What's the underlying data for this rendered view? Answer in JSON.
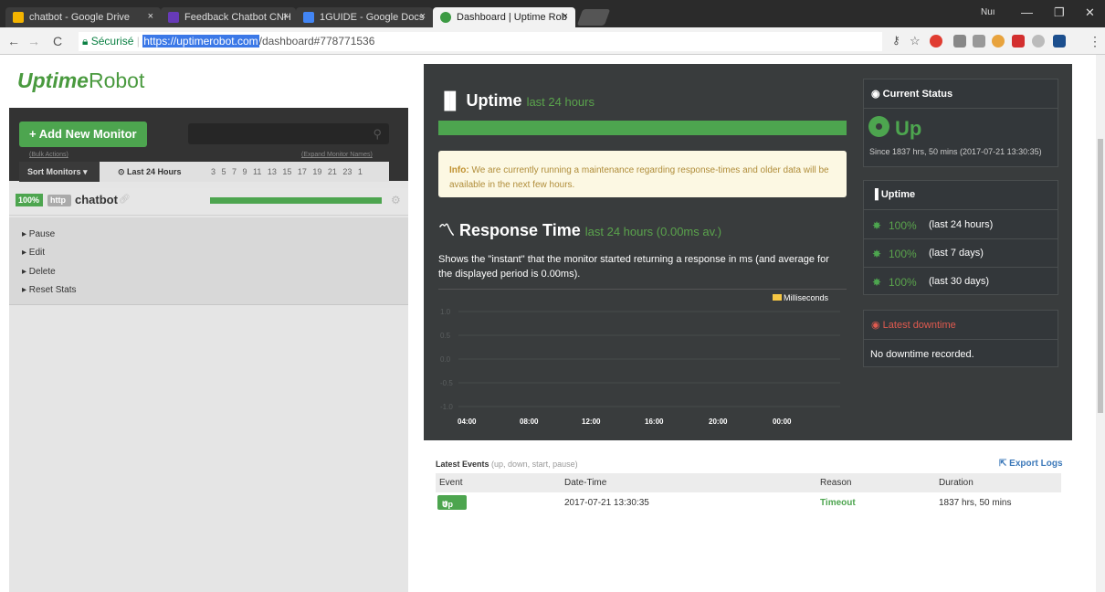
{
  "browser": {
    "tabs": [
      {
        "title": "chatbot - Google Drive",
        "close": "×",
        "icon_color": "#f4b400"
      },
      {
        "title": "Feedback Chatbot CNH",
        "close": "×",
        "icon_color": "#673ab7"
      },
      {
        "title": "1GUIDE - Google Docs",
        "close": "×",
        "icon_color": "#4285f4"
      },
      {
        "title": "Dashboard | Uptime Rob",
        "close": "×",
        "icon_color": "#3c9a43"
      }
    ],
    "user": "Nuı",
    "secure_label": "Sécurisé",
    "url_highlight": "https://uptimerobot.com",
    "url_rest": "/dashboard#778771536"
  },
  "sidebar": {
    "logo_uptime": "Uptime",
    "logo_robot": "Robot",
    "add_button": "+ Add New Monitor",
    "bulk_actions": "(Bulk Actions)",
    "expand_names": "(Expand Monitor Names)",
    "sort_button": "Sort Monitors ▾",
    "last_24": "⊙ Last 24 Hours",
    "hours": "3 5 7 9 11 13 15 17 19 21 23 1",
    "monitor": {
      "pct": "100%",
      "protocol": "http",
      "name": "chatbot",
      "uptime": 1.0
    },
    "menu": [
      "▸ Pause",
      "▸ Edit",
      "▸ Delete",
      "▸ Reset Stats"
    ]
  },
  "main": {
    "uptime_title": "Uptime",
    "uptime_sub": "last 24 hours",
    "info_label": "Info:",
    "info_text": "We are currently running a maintenance regarding response-times and older data will be available in the next few hours.",
    "response_title": "Response Time",
    "response_sub": "last 24 hours (0.00ms av.)",
    "response_desc": "Shows the \"instant\" that the monitor started returning a response in ms (and average for the displayed period is 0.00ms)."
  },
  "chart_data": {
    "type": "line",
    "title": "",
    "series": [
      {
        "name": "Milliseconds",
        "values": []
      }
    ],
    "x_ticks": [
      "04:00",
      "08:00",
      "12:00",
      "16:00",
      "20:00",
      "00:00"
    ],
    "y_ticks": [
      "1.0",
      "0.5",
      "0.0",
      "-0.5",
      "-1.0"
    ],
    "ylim": [
      -1.0,
      1.0
    ],
    "legend": "top-right",
    "legend_color": "#f6c744"
  },
  "status": {
    "current_title": "Current Status",
    "current_value": "Up",
    "since": "Since 1837 hrs, 50 mins (2017-07-21 13:30:35)",
    "uptime_title": "Uptime",
    "uptime_rows": [
      {
        "value": "100%",
        "period": "(last 24 hours)"
      },
      {
        "value": "100%",
        "period": "(last 7 days)"
      },
      {
        "value": "100%",
        "period": "(last 30 days)"
      }
    ],
    "downtime_title": "Latest downtime",
    "downtime_text": "No downtime recorded."
  },
  "events": {
    "title": "Latest Events",
    "title_sub": "(up, down, start, pause)",
    "export": "Export Logs",
    "headers": [
      "Event",
      "Date-Time",
      "Reason",
      "Duration"
    ],
    "rows": [
      {
        "event": "Up",
        "datetime": "2017-07-21 13:30:35",
        "reason": "Timeout",
        "duration": "1837 hrs, 50 mins"
      }
    ]
  }
}
